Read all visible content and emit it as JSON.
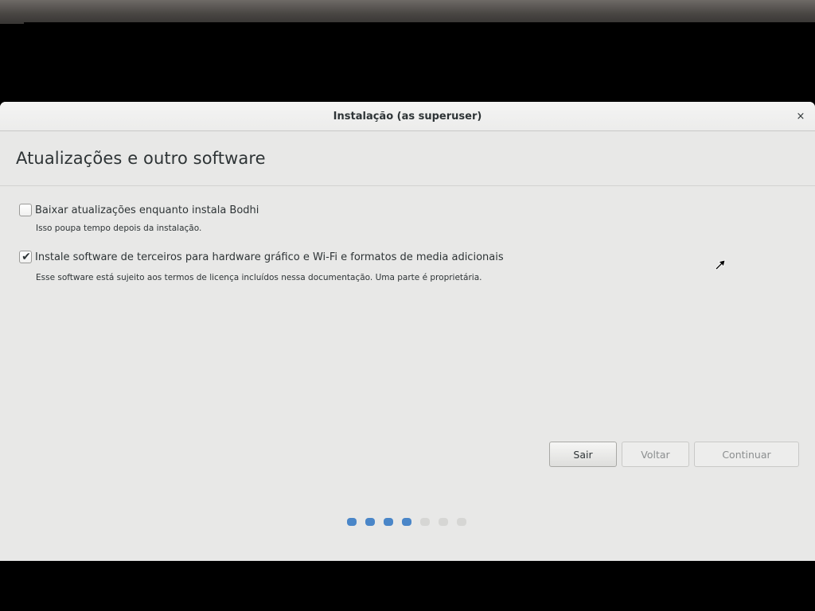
{
  "window": {
    "title": "Instalação (as superuser)",
    "close_glyph": "×"
  },
  "page": {
    "title": "Atualizações e outro software"
  },
  "options": [
    {
      "label": "Baixar atualizações enquanto instala Bodhi",
      "description": "Isso poupa tempo depois da instalação.",
      "checked": false
    },
    {
      "label": "Instale software de terceiros para hardware gráfico e Wi-Fi e formatos de media adicionais",
      "description": "Esse software está sujeito aos termos de licença incluídos nessa documentação. Uma parte é proprietária.",
      "checked": true,
      "check_glyph": "✔"
    }
  ],
  "buttons": {
    "quit": "Sair",
    "back": "Voltar",
    "continue": "Continuar"
  },
  "progress": {
    "completed_steps": 4,
    "total_steps": 7
  },
  "colors": {
    "progress_done": "#4a86c8",
    "progress_todo": "#d6d6d4",
    "window_bg": "#e8e8e7"
  },
  "icons": {
    "close": "close-icon",
    "checkmark": "checkmark-icon",
    "cursor": "mouse-pointer-icon"
  }
}
